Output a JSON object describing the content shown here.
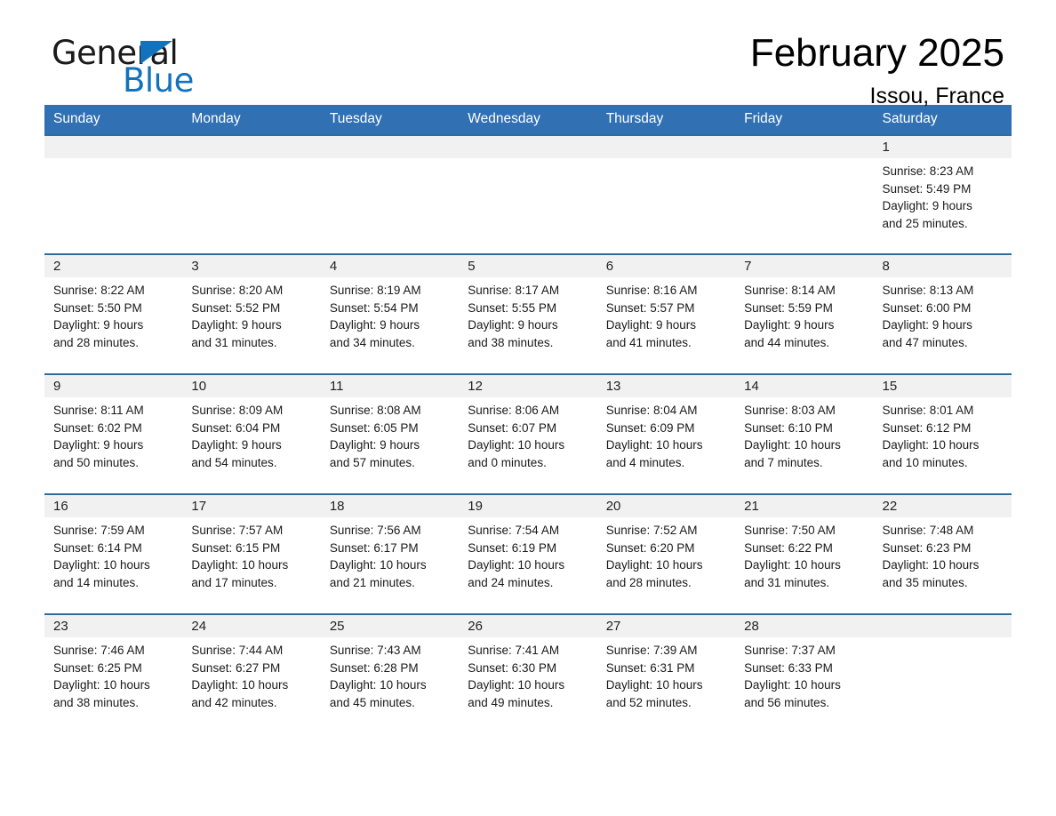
{
  "brand": {
    "name_part1": "General",
    "name_part2": "Blue",
    "logo_icon": "triangle-icon"
  },
  "header": {
    "title": "February 2025",
    "subtitle": "Issou, France"
  },
  "colors": {
    "header_blue": "#3070b3",
    "row_divider_blue": "#2e6da4",
    "daynum_band": "#f1f1f1",
    "brand_blue": "#1272bb"
  },
  "weekday_headers": [
    "Sunday",
    "Monday",
    "Tuesday",
    "Wednesday",
    "Thursday",
    "Friday",
    "Saturday"
  ],
  "weeks": [
    [
      {
        "day": "",
        "sunrise": "",
        "sunset": "",
        "daylight_line1": "",
        "daylight_line2": "",
        "empty": true
      },
      {
        "day": "",
        "sunrise": "",
        "sunset": "",
        "daylight_line1": "",
        "daylight_line2": "",
        "empty": true
      },
      {
        "day": "",
        "sunrise": "",
        "sunset": "",
        "daylight_line1": "",
        "daylight_line2": "",
        "empty": true
      },
      {
        "day": "",
        "sunrise": "",
        "sunset": "",
        "daylight_line1": "",
        "daylight_line2": "",
        "empty": true
      },
      {
        "day": "",
        "sunrise": "",
        "sunset": "",
        "daylight_line1": "",
        "daylight_line2": "",
        "empty": true
      },
      {
        "day": "",
        "sunrise": "",
        "sunset": "",
        "daylight_line1": "",
        "daylight_line2": "",
        "empty": true
      },
      {
        "day": "1",
        "sunrise": "Sunrise: 8:23 AM",
        "sunset": "Sunset: 5:49 PM",
        "daylight_line1": "Daylight: 9 hours",
        "daylight_line2": "and 25 minutes.",
        "empty": false
      }
    ],
    [
      {
        "day": "2",
        "sunrise": "Sunrise: 8:22 AM",
        "sunset": "Sunset: 5:50 PM",
        "daylight_line1": "Daylight: 9 hours",
        "daylight_line2": "and 28 minutes.",
        "empty": false
      },
      {
        "day": "3",
        "sunrise": "Sunrise: 8:20 AM",
        "sunset": "Sunset: 5:52 PM",
        "daylight_line1": "Daylight: 9 hours",
        "daylight_line2": "and 31 minutes.",
        "empty": false
      },
      {
        "day": "4",
        "sunrise": "Sunrise: 8:19 AM",
        "sunset": "Sunset: 5:54 PM",
        "daylight_line1": "Daylight: 9 hours",
        "daylight_line2": "and 34 minutes.",
        "empty": false
      },
      {
        "day": "5",
        "sunrise": "Sunrise: 8:17 AM",
        "sunset": "Sunset: 5:55 PM",
        "daylight_line1": "Daylight: 9 hours",
        "daylight_line2": "and 38 minutes.",
        "empty": false
      },
      {
        "day": "6",
        "sunrise": "Sunrise: 8:16 AM",
        "sunset": "Sunset: 5:57 PM",
        "daylight_line1": "Daylight: 9 hours",
        "daylight_line2": "and 41 minutes.",
        "empty": false
      },
      {
        "day": "7",
        "sunrise": "Sunrise: 8:14 AM",
        "sunset": "Sunset: 5:59 PM",
        "daylight_line1": "Daylight: 9 hours",
        "daylight_line2": "and 44 minutes.",
        "empty": false
      },
      {
        "day": "8",
        "sunrise": "Sunrise: 8:13 AM",
        "sunset": "Sunset: 6:00 PM",
        "daylight_line1": "Daylight: 9 hours",
        "daylight_line2": "and 47 minutes.",
        "empty": false
      }
    ],
    [
      {
        "day": "9",
        "sunrise": "Sunrise: 8:11 AM",
        "sunset": "Sunset: 6:02 PM",
        "daylight_line1": "Daylight: 9 hours",
        "daylight_line2": "and 50 minutes.",
        "empty": false
      },
      {
        "day": "10",
        "sunrise": "Sunrise: 8:09 AM",
        "sunset": "Sunset: 6:04 PM",
        "daylight_line1": "Daylight: 9 hours",
        "daylight_line2": "and 54 minutes.",
        "empty": false
      },
      {
        "day": "11",
        "sunrise": "Sunrise: 8:08 AM",
        "sunset": "Sunset: 6:05 PM",
        "daylight_line1": "Daylight: 9 hours",
        "daylight_line2": "and 57 minutes.",
        "empty": false
      },
      {
        "day": "12",
        "sunrise": "Sunrise: 8:06 AM",
        "sunset": "Sunset: 6:07 PM",
        "daylight_line1": "Daylight: 10 hours",
        "daylight_line2": "and 0 minutes.",
        "empty": false
      },
      {
        "day": "13",
        "sunrise": "Sunrise: 8:04 AM",
        "sunset": "Sunset: 6:09 PM",
        "daylight_line1": "Daylight: 10 hours",
        "daylight_line2": "and 4 minutes.",
        "empty": false
      },
      {
        "day": "14",
        "sunrise": "Sunrise: 8:03 AM",
        "sunset": "Sunset: 6:10 PM",
        "daylight_line1": "Daylight: 10 hours",
        "daylight_line2": "and 7 minutes.",
        "empty": false
      },
      {
        "day": "15",
        "sunrise": "Sunrise: 8:01 AM",
        "sunset": "Sunset: 6:12 PM",
        "daylight_line1": "Daylight: 10 hours",
        "daylight_line2": "and 10 minutes.",
        "empty": false
      }
    ],
    [
      {
        "day": "16",
        "sunrise": "Sunrise: 7:59 AM",
        "sunset": "Sunset: 6:14 PM",
        "daylight_line1": "Daylight: 10 hours",
        "daylight_line2": "and 14 minutes.",
        "empty": false
      },
      {
        "day": "17",
        "sunrise": "Sunrise: 7:57 AM",
        "sunset": "Sunset: 6:15 PM",
        "daylight_line1": "Daylight: 10 hours",
        "daylight_line2": "and 17 minutes.",
        "empty": false
      },
      {
        "day": "18",
        "sunrise": "Sunrise: 7:56 AM",
        "sunset": "Sunset: 6:17 PM",
        "daylight_line1": "Daylight: 10 hours",
        "daylight_line2": "and 21 minutes.",
        "empty": false
      },
      {
        "day": "19",
        "sunrise": "Sunrise: 7:54 AM",
        "sunset": "Sunset: 6:19 PM",
        "daylight_line1": "Daylight: 10 hours",
        "daylight_line2": "and 24 minutes.",
        "empty": false
      },
      {
        "day": "20",
        "sunrise": "Sunrise: 7:52 AM",
        "sunset": "Sunset: 6:20 PM",
        "daylight_line1": "Daylight: 10 hours",
        "daylight_line2": "and 28 minutes.",
        "empty": false
      },
      {
        "day": "21",
        "sunrise": "Sunrise: 7:50 AM",
        "sunset": "Sunset: 6:22 PM",
        "daylight_line1": "Daylight: 10 hours",
        "daylight_line2": "and 31 minutes.",
        "empty": false
      },
      {
        "day": "22",
        "sunrise": "Sunrise: 7:48 AM",
        "sunset": "Sunset: 6:23 PM",
        "daylight_line1": "Daylight: 10 hours",
        "daylight_line2": "and 35 minutes.",
        "empty": false
      }
    ],
    [
      {
        "day": "23",
        "sunrise": "Sunrise: 7:46 AM",
        "sunset": "Sunset: 6:25 PM",
        "daylight_line1": "Daylight: 10 hours",
        "daylight_line2": "and 38 minutes.",
        "empty": false
      },
      {
        "day": "24",
        "sunrise": "Sunrise: 7:44 AM",
        "sunset": "Sunset: 6:27 PM",
        "daylight_line1": "Daylight: 10 hours",
        "daylight_line2": "and 42 minutes.",
        "empty": false
      },
      {
        "day": "25",
        "sunrise": "Sunrise: 7:43 AM",
        "sunset": "Sunset: 6:28 PM",
        "daylight_line1": "Daylight: 10 hours",
        "daylight_line2": "and 45 minutes.",
        "empty": false
      },
      {
        "day": "26",
        "sunrise": "Sunrise: 7:41 AM",
        "sunset": "Sunset: 6:30 PM",
        "daylight_line1": "Daylight: 10 hours",
        "daylight_line2": "and 49 minutes.",
        "empty": false
      },
      {
        "day": "27",
        "sunrise": "Sunrise: 7:39 AM",
        "sunset": "Sunset: 6:31 PM",
        "daylight_line1": "Daylight: 10 hours",
        "daylight_line2": "and 52 minutes.",
        "empty": false
      },
      {
        "day": "28",
        "sunrise": "Sunrise: 7:37 AM",
        "sunset": "Sunset: 6:33 PM",
        "daylight_line1": "Daylight: 10 hours",
        "daylight_line2": "and 56 minutes.",
        "empty": false
      },
      {
        "day": "",
        "sunrise": "",
        "sunset": "",
        "daylight_line1": "",
        "daylight_line2": "",
        "empty": true
      }
    ]
  ]
}
